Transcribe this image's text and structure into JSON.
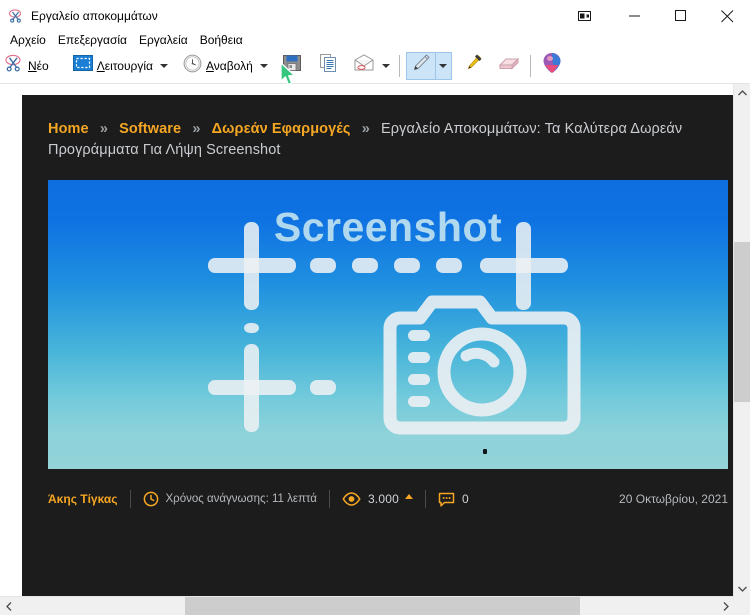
{
  "window": {
    "title": "Εργαλείο αποκομμάτων",
    "icon": "snipping-tool-icon",
    "controls": {
      "restore_down": "▭",
      "minimize": "—",
      "maximize": "☐",
      "close": "✕"
    }
  },
  "menu": {
    "items": [
      {
        "label": "Αρχείο",
        "name": "menu-file"
      },
      {
        "label": "Επεξεργασία",
        "name": "menu-edit"
      },
      {
        "label": "Εργαλεία",
        "name": "menu-tools"
      },
      {
        "label": "Βοήθεια",
        "name": "menu-help"
      }
    ]
  },
  "toolbar": {
    "new_label": "Νέο",
    "new_label_prefix": "Ν",
    "new_label_rest": "έο",
    "mode_label": "Λειτουργία",
    "mode_label_prefix": "Λ",
    "mode_label_rest": "ειτουργία",
    "delay_label": "Αναβολή",
    "delay_label_prefix": "Α",
    "delay_label_rest": "ναβολή",
    "icons": {
      "new": "scissors-icon",
      "mode": "rectangle-select-icon",
      "delay": "clock-icon",
      "save": "save-floppy-icon",
      "copy": "copy-icon",
      "email": "email-icon",
      "pen": "pen-icon",
      "highlighter": "highlighter-icon",
      "eraser": "eraser-icon",
      "paint3d": "paint-3d-icon"
    },
    "pen_selected": true
  },
  "capture": {
    "breadcrumb": {
      "items": [
        {
          "label": "Home",
          "type": "link"
        },
        {
          "label": "Software",
          "type": "link"
        },
        {
          "label": "Δωρεάν Εφαρμογές",
          "type": "link"
        }
      ],
      "separator": "»",
      "current": "Εργαλείο Αποκομμάτων: Τα Καλύτερα Δωρεάν Προγράμματα Για Λήψη Screenshot"
    },
    "hero": {
      "title": "Screenshot",
      "graphic": "camera-and-crop-crosshair-icon",
      "gradient_top": "#0d6fe0",
      "gradient_bottom": "#93d3d8"
    },
    "meta": {
      "author": "Άκης Τίγκας",
      "reading_time_icon": "clock-icon",
      "reading_time": "Χρόνος ανάγνωσης: 11 λεπτά",
      "views_icon": "eye-icon",
      "views": "3.000",
      "comments_icon": "comment-bubble-icon",
      "comments": "0",
      "date": "20 Οκτωβρίου, 2021",
      "accent_color": "#f5a623"
    },
    "background_color": "#1c1c1c"
  },
  "scrollbars": {
    "vertical": {
      "up": "⌃",
      "down": "⌄"
    },
    "horizontal": {
      "left": "‹",
      "right": "›"
    }
  }
}
